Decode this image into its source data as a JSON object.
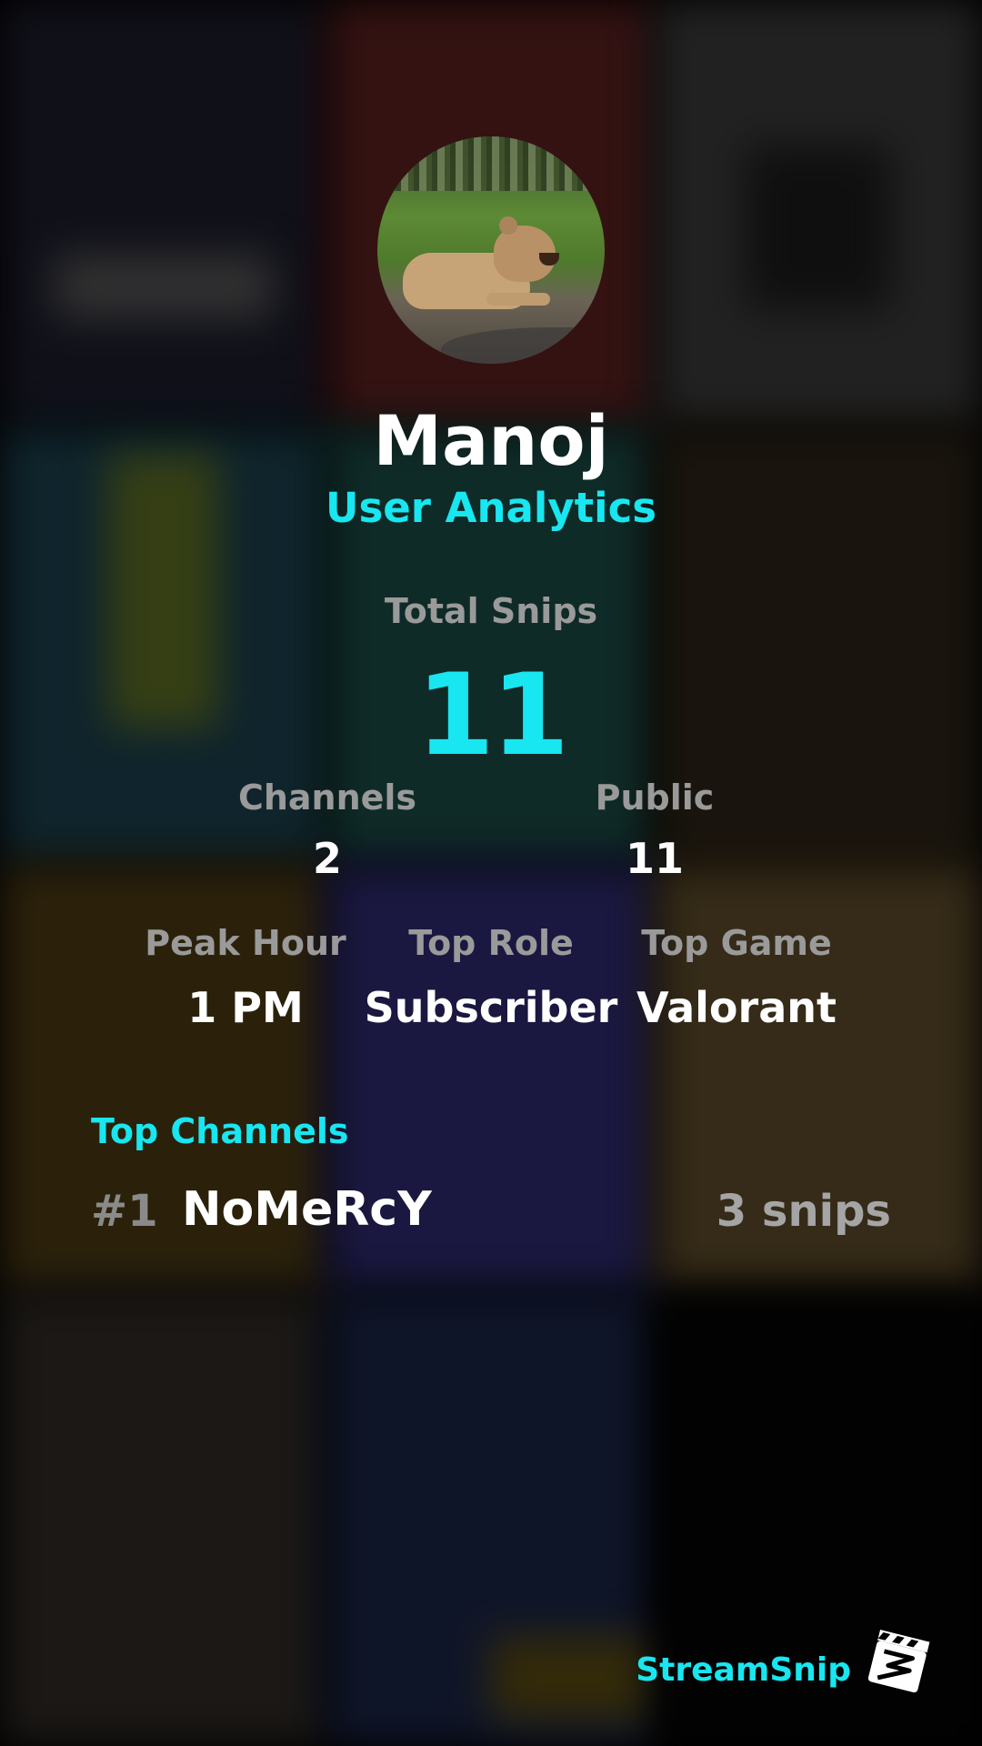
{
  "profile": {
    "username": "Manoj",
    "subtitle": "User Analytics",
    "avatar_icon": "lion-photo"
  },
  "stats": {
    "total_snips_label": "Total Snips",
    "total_snips_value": "11",
    "channels_label": "Channels",
    "channels_value": "2",
    "public_label": "Public",
    "public_value": "11",
    "peak_hour_label": "Peak Hour",
    "peak_hour_value": "1 PM",
    "top_role_label": "Top Role",
    "top_role_value": "Subscriber",
    "top_game_label": "Top Game",
    "top_game_value": "Valorant"
  },
  "top_channels": {
    "title": "Top Channels",
    "items": [
      {
        "rank": "#1",
        "name": "NoMeRcY",
        "snips": "3 snips"
      }
    ]
  },
  "brand": {
    "name": "StreamSnip",
    "logo_icon": "clapperboard-icon"
  },
  "colors": {
    "accent": "#18e6f0",
    "muted": "#9a9a9a",
    "background": "#000000"
  }
}
